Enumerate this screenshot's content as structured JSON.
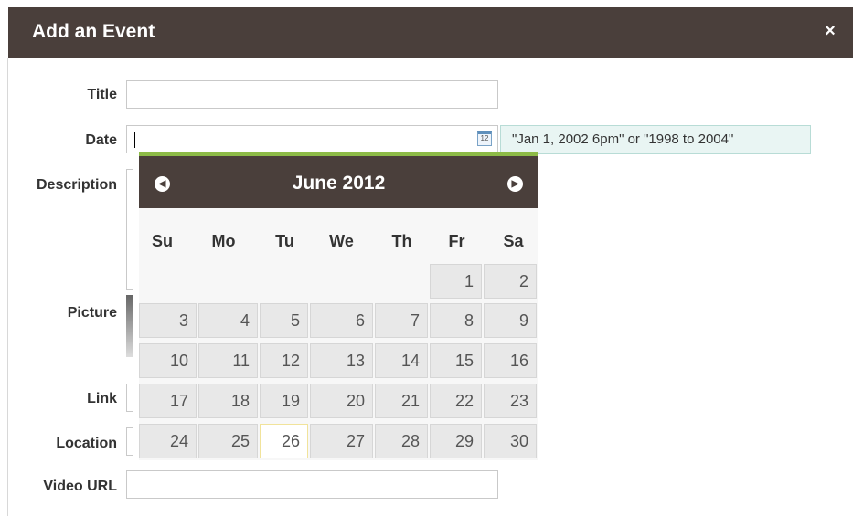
{
  "dialog": {
    "title": "Add an Event",
    "close_label": "×"
  },
  "form": {
    "labels": {
      "title": "Title",
      "date": "Date",
      "description": "Description",
      "picture": "Picture",
      "link": "Link",
      "location": "Location",
      "video_url": "Video URL"
    },
    "values": {
      "title": "",
      "date": "",
      "video_url": ""
    },
    "date_hint": "\"Jan 1, 2002 6pm\" or \"1998 to 2004\"",
    "calendar_icon_text": "12"
  },
  "calendar": {
    "month_label": "June 2012",
    "prev_glyph": "◀",
    "next_glyph": "▶",
    "weekdays": [
      "Su",
      "Mo",
      "Tu",
      "We",
      "Th",
      "Fr",
      "Sa"
    ],
    "today": "26",
    "days": [
      "1",
      "2",
      "3",
      "4",
      "5",
      "6",
      "7",
      "8",
      "9",
      "10",
      "11",
      "12",
      "13",
      "14",
      "15",
      "16",
      "17",
      "18",
      "19",
      "20",
      "21",
      "22",
      "23",
      "24",
      "25",
      "26",
      "27",
      "28",
      "29",
      "30"
    ]
  },
  "colors": {
    "header_bg": "#4a3f3b",
    "calendar_accent": "#8dbb47",
    "hint_bg": "#e9f5f3"
  }
}
